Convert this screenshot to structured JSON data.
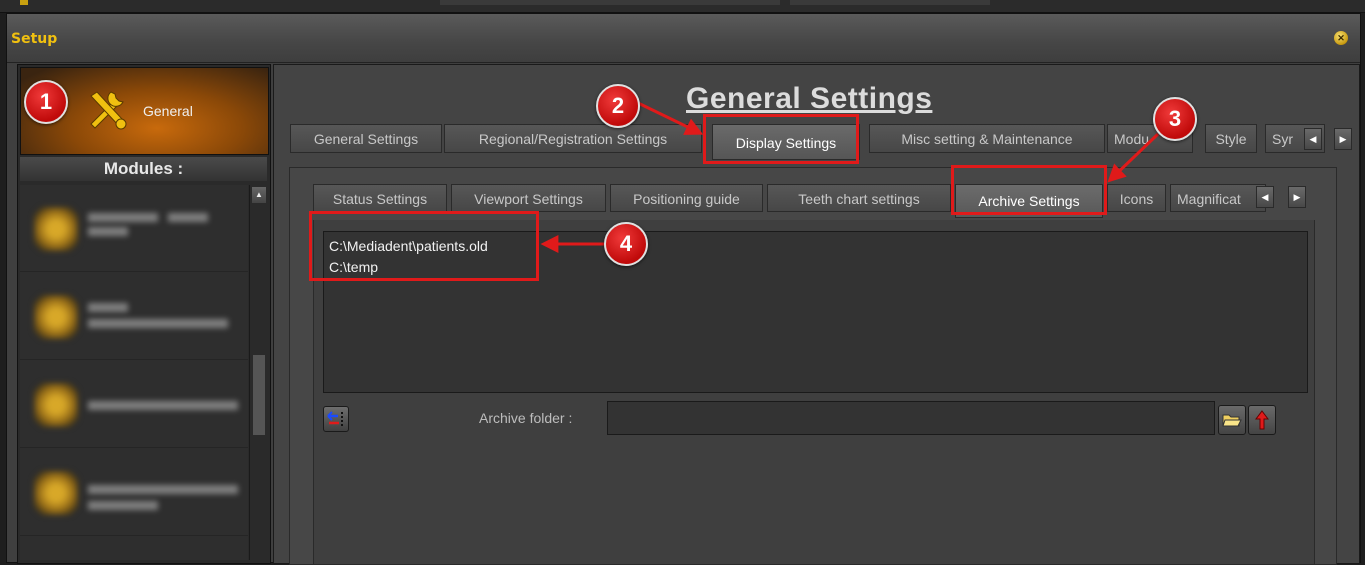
{
  "window": {
    "title": "Setup",
    "close_icon": "close-icon"
  },
  "sidebar": {
    "general_label": "General",
    "modules_header": "Modules :",
    "modules": [
      {
        "blurred": true
      },
      {
        "blurred": true
      },
      {
        "blurred": true
      },
      {
        "blurred": true
      }
    ]
  },
  "main": {
    "heading": "General Settings",
    "tabs": [
      {
        "label": "General Settings"
      },
      {
        "label": "Regional/Registration Settings"
      },
      {
        "label": "Display Settings"
      },
      {
        "label": "Misc setting & Maintenance"
      },
      {
        "label": "Modu"
      },
      {
        "label": "Style"
      },
      {
        "label": "Syr"
      }
    ],
    "sub_tabs": [
      {
        "label": "Status Settings"
      },
      {
        "label": "Viewport Settings"
      },
      {
        "label": "Positioning guide"
      },
      {
        "label": "Teeth chart settings"
      },
      {
        "label": "Archive Settings"
      },
      {
        "label": "Icons"
      },
      {
        "label": "Magnificat"
      }
    ],
    "archive_paths": [
      "C:\\Mediadent\\patients.old",
      "C:\\temp"
    ],
    "archive_folder_label": "Archive folder :",
    "archive_folder_value": ""
  },
  "annotations": [
    "1",
    "2",
    "3",
    "4"
  ],
  "colors": {
    "title": "#f0c010",
    "highlight": "#e01a1a",
    "callout": "#d01010"
  }
}
